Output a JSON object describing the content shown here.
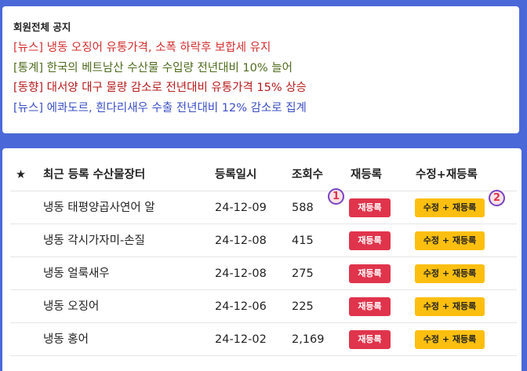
{
  "notice": {
    "title": "회원전체 공지",
    "items": [
      {
        "text": "[뉴스] 냉동 오징어 유통가격, 소폭 하락후 보합세 유지",
        "color": "#d32f2f"
      },
      {
        "text": "[통계] 한국의 베트남산 수산물 수입량 전년대비 10% 늘어",
        "color": "#4f6b1e"
      },
      {
        "text": "[동향] 대서양 대구 물량 감소로 전년대비 유통가격 15% 상승",
        "color": "#b71c1c"
      },
      {
        "text": "[뉴스] 에콰도르, 흰다리새우 수출 전년대비 12% 감소로 집계",
        "color": "#3b4fc4"
      }
    ]
  },
  "table": {
    "star": "★",
    "headers": {
      "name": "최근 등록 수산물장터",
      "date": "등록일시",
      "views": "조회수",
      "rereg": "재등록",
      "edit_rereg": "수정+재등록"
    },
    "rereg_label": "재등록",
    "edit_rereg_label": "수정 + 재등록",
    "rows": [
      {
        "name": "냉동 태평양곱사연어 알",
        "date": "24-12-09",
        "views": "588"
      },
      {
        "name": "냉동 각시가자미-손질",
        "date": "24-12-08",
        "views": "415"
      },
      {
        "name": "냉동 얼룩새우",
        "date": "24-12-08",
        "views": "275"
      },
      {
        "name": "냉동 오징어",
        "date": "24-12-06",
        "views": "225"
      },
      {
        "name": "냉동 홍어",
        "date": "24-12-02",
        "views": "2,169"
      }
    ]
  },
  "markers": [
    "1",
    "2"
  ],
  "colors": {
    "background": "#4a68d8",
    "rereg_button": "#e0344c",
    "edit_button": "#fcbf10",
    "marker_border": "#7a44c4"
  }
}
